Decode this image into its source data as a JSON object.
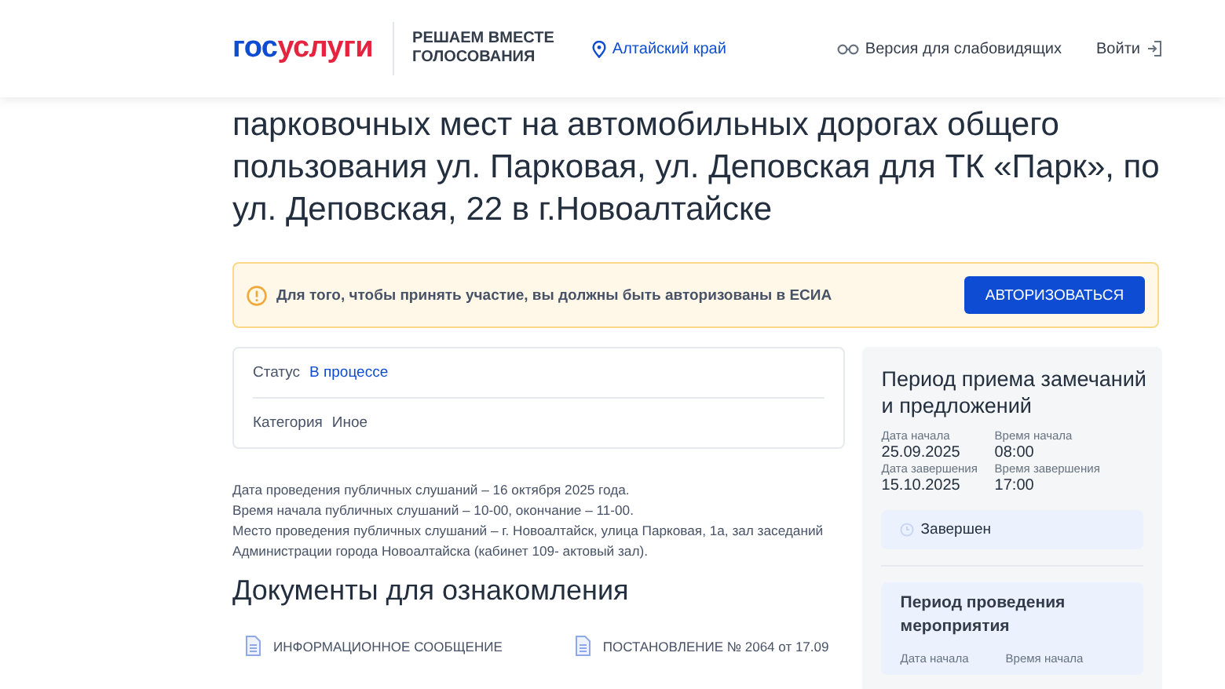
{
  "header": {
    "logo": {
      "first": "гос",
      "second": "услуги"
    },
    "tagline": [
      "РЕШАЕМ ВМЕСТЕ",
      "ГОЛОСОВАНИЯ"
    ],
    "region": "Алтайский край",
    "accessibility": "Версия для слабовидящих",
    "login": "Войти"
  },
  "title_lines": [
    "парковочных мест на автомобильных дорогах общего",
    "пользования ул. Парковая, ул. Деповская для ТК «Парк», по",
    "ул. Деповская, 22 в г.Новоалтайске"
  ],
  "alert": {
    "text": "Для того, чтобы принять участие, вы должны быть авторизованы в ЕСИА",
    "button": "АВТОРИЗОВАТЬСЯ"
  },
  "info": [
    {
      "label": "Статус",
      "value": "В процессе",
      "kind": "link"
    },
    {
      "label": "Категория",
      "value": "Иное",
      "kind": "plain"
    }
  ],
  "description": [
    "Дата проведения публичных слушаний – 16 октября 2025 года.",
    "Время начала публичных слушаний – 10-00, окончание – 11-00.",
    "Место проведения публичных слушаний – г. Новоалтайск, улица Парковая, 1а, зал заседаний",
    "Администрации города Новоалтайска (кабинет 109- актовый зал)."
  ],
  "documents_title": "Документы для ознакомления",
  "documents": [
    "ИНФОРМАЦИОННОЕ СООБЩЕНИЕ",
    "ПОСТАНОВЛЕНИЕ № 2064 от 17.09"
  ],
  "sidebar": {
    "title": "Период приема замечаний и предложений",
    "fields": [
      {
        "label": "Дата начала",
        "value": "25.09.2025"
      },
      {
        "label": "Время начала",
        "value": "08:00"
      },
      {
        "label": "Дата завершения",
        "value": "15.10.2025"
      },
      {
        "label": "Время завершения",
        "value": "17:00"
      }
    ],
    "status": "Завершен",
    "event": {
      "title": "Период проведения мероприятия",
      "labels": [
        "Дата начала",
        "Время начала"
      ]
    }
  }
}
